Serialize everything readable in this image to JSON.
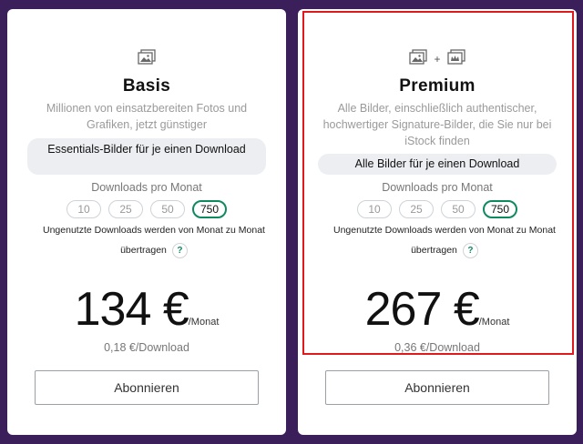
{
  "plans": {
    "basis": {
      "icons": [
        "stock-photo-icon"
      ],
      "title": "Basis",
      "description": "Millionen von einsatzbereiten Fotos und Grafiken, jetzt günstiger",
      "pill": "Essentials-Bilder für je einen Download",
      "downloads_label": "Downloads pro Monat",
      "options": [
        "10",
        "25",
        "50",
        "750"
      ],
      "selected_option": "750",
      "rollover": "Ungenutzte Downloads werden von Monat zu Monat übertragen",
      "help": "?",
      "price": "134 €",
      "per_month": "/Monat",
      "per_download": "0,18 €/Download",
      "button": "Abonnieren"
    },
    "premium": {
      "icons": [
        "stock-photo-icon",
        "plus",
        "signature-photo-icon"
      ],
      "plus_symbol": "+",
      "title": "Premium",
      "description": "Alle Bilder, einschließlich authentischer, hochwertiger Signature-Bilder, die Sie nur bei iStock finden",
      "pill": "Alle Bilder für je einen Download",
      "downloads_label": "Downloads pro Monat",
      "options": [
        "10",
        "25",
        "50",
        "750"
      ],
      "selected_option": "750",
      "rollover": "Ungenutzte Downloads werden von Monat zu Monat übertragen",
      "help": "?",
      "price": "267 €",
      "per_month": "/Monat",
      "per_download": "0,36 €/Download",
      "button": "Abonnieren"
    }
  },
  "colors": {
    "background": "#3a1f5a",
    "selected_border": "#0f8a5f",
    "highlight_border": "#e0191f"
  }
}
